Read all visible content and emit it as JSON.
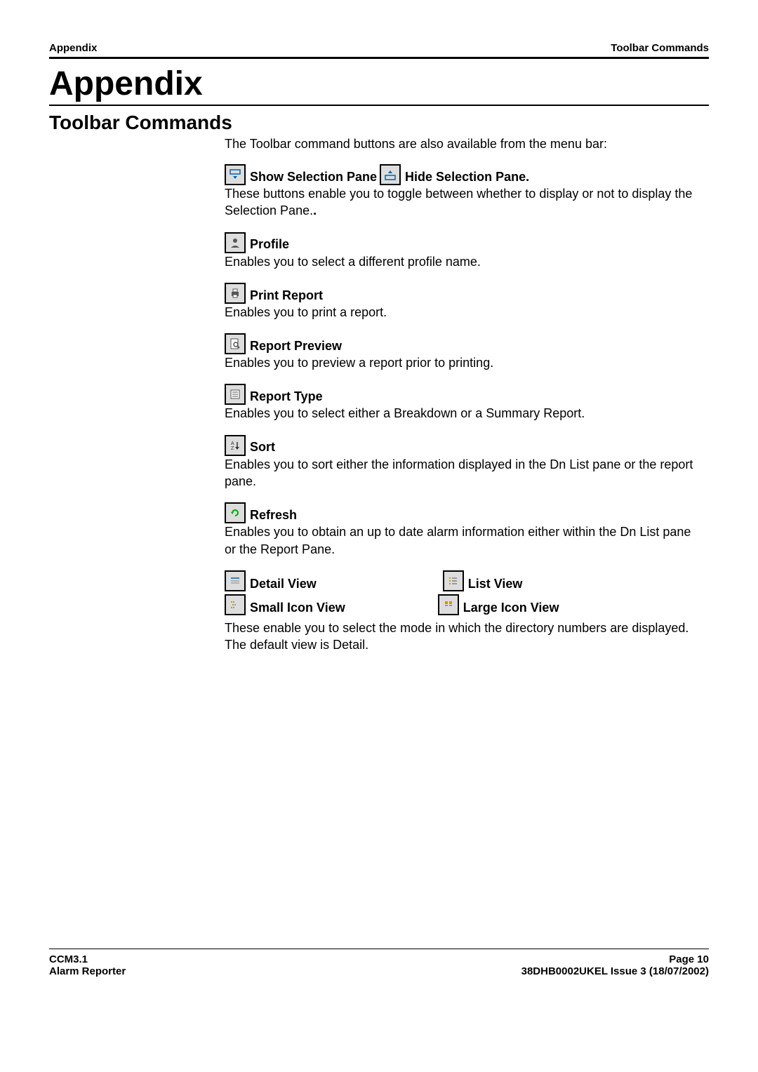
{
  "header": {
    "left": "Appendix",
    "right": "Toolbar Commands"
  },
  "title": "Appendix",
  "subtitle": "Toolbar Commands",
  "intro": "The Toolbar command buttons are also available from the menu bar:",
  "items": {
    "selectionPane": {
      "label1": " Show Selection Pane",
      "label2": " Hide Selection Pane.",
      "desc": "These buttons enable you to toggle between whether to display or not to display the Selection Pane.",
      "trailingBold": "."
    },
    "profile": {
      "label": " Profile",
      "desc": "Enables you to select a different profile name."
    },
    "printReport": {
      "label": " Print Report",
      "desc": "Enables you to print a report."
    },
    "reportPreview": {
      "label": " Report Preview",
      "desc": "Enables you to preview a report prior to printing."
    },
    "reportType": {
      "label": " Report Type",
      "desc": "Enables you to select either a Breakdown or a Summary Report."
    },
    "sort": {
      "label": " Sort",
      "desc": "Enables you to sort either the information displayed in the Dn List pane or the report pane."
    },
    "refresh": {
      "label": " Refresh",
      "desc": "Enables you to obtain an up to date alarm information either within the Dn List pane or the Report Pane."
    },
    "views": {
      "detail": " Detail View",
      "list": " List View",
      "smallIcon": " Small Icon View",
      "largeIcon": " Large Icon View",
      "desc": "These enable you to select the mode in which the directory numbers are displayed.  The default view is Detail."
    }
  },
  "footer": {
    "leftTop": "CCM3.1",
    "leftBottom": "Alarm Reporter",
    "rightTop": "Page 10",
    "rightBottom": "38DHB0002UKEL Issue 3 (18/07/2002)"
  }
}
